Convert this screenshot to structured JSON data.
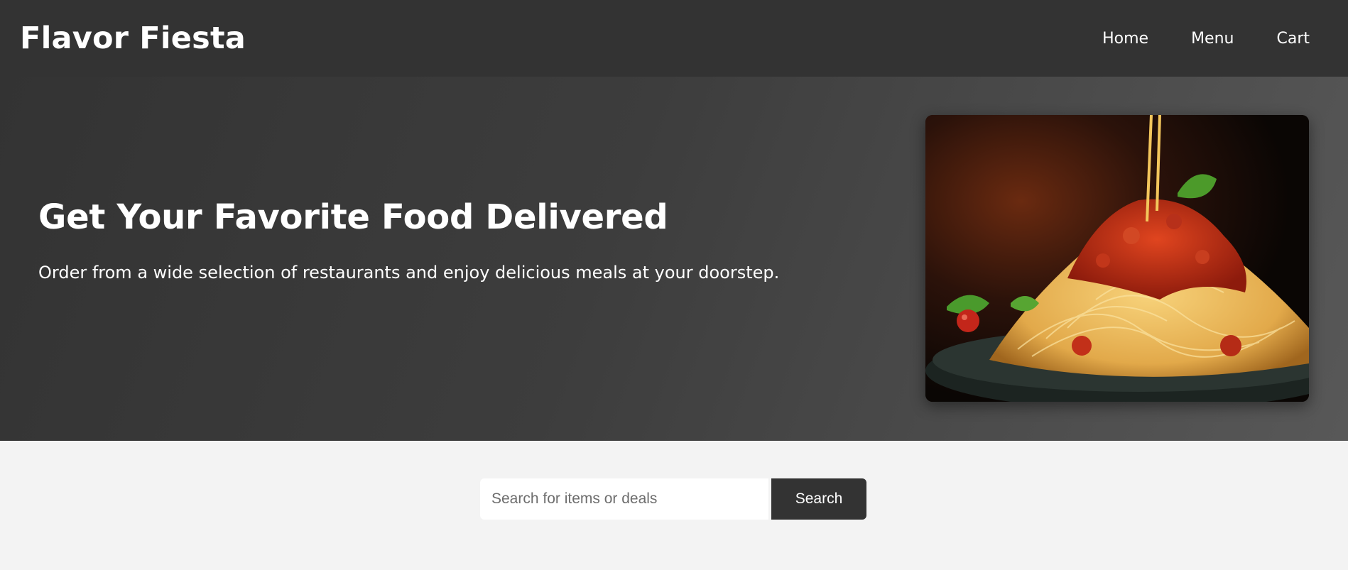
{
  "header": {
    "brand": "Flavor Fiesta",
    "nav": [
      {
        "label": "Home"
      },
      {
        "label": "Menu"
      },
      {
        "label": "Cart"
      }
    ]
  },
  "hero": {
    "title": "Get Your Favorite Food Delivered",
    "subtitle": "Order from a wide selection of restaurants and enjoy delicious meals at your doorstep.",
    "image": "spaghetti-with-tomato-sauce-photo"
  },
  "search": {
    "placeholder": "Search for items or deals",
    "button_label": "Search"
  },
  "colors": {
    "header_bg": "#333333",
    "page_bg": "#f3f3f3",
    "button_bg": "#333333"
  }
}
